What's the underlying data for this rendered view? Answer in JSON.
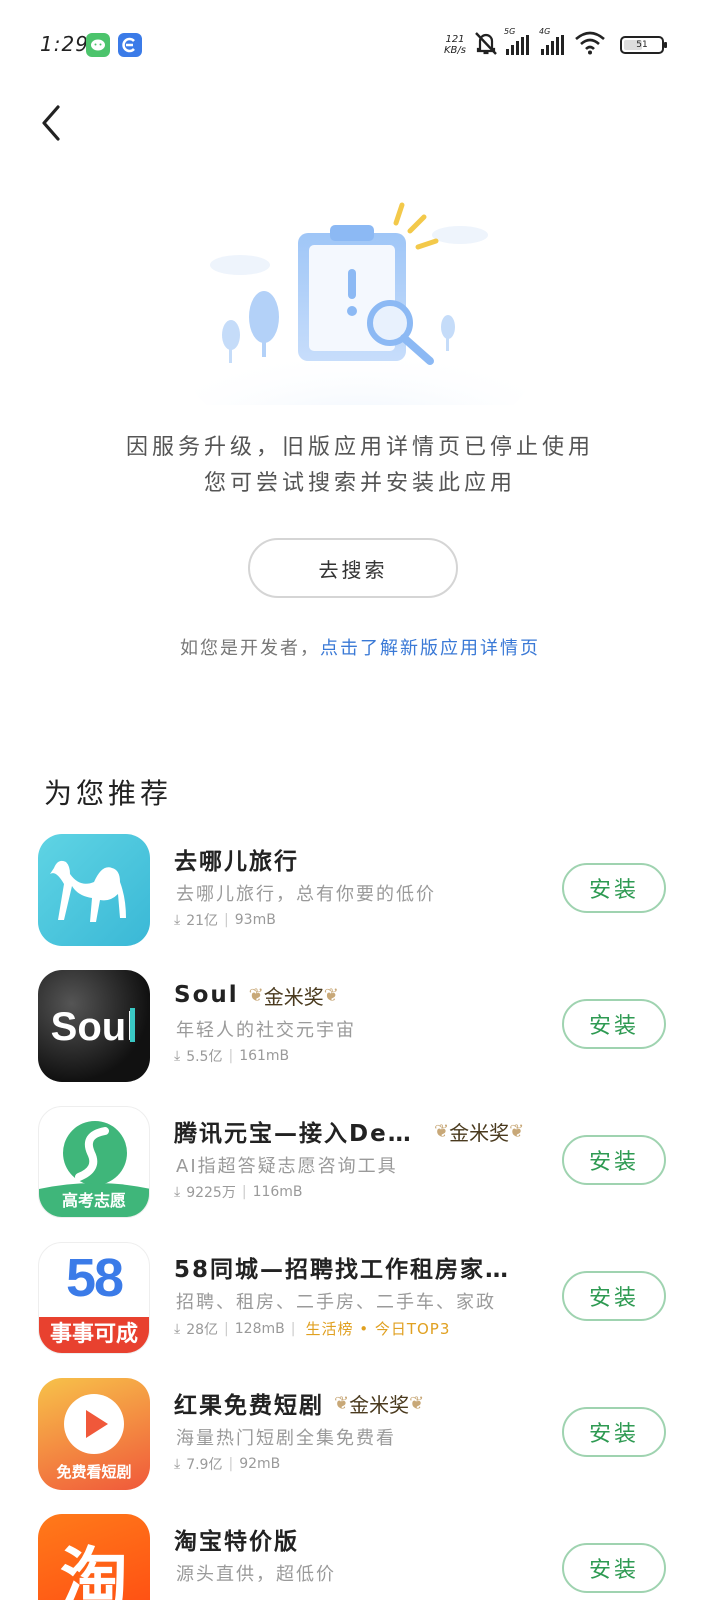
{
  "status_bar": {
    "time": "1:29",
    "net_speed_value": "121",
    "net_speed_unit": "KB/s",
    "signal_tag_1": "5G",
    "signal_tag_2": "4G",
    "battery": "51",
    "battery_level": 0.51
  },
  "notice": {
    "line1": "因服务升级，旧版应用详情页已停止使用",
    "line2": "您可尝试搜索并安装此应用"
  },
  "search_button": "去搜索",
  "developer": {
    "prefix": "如您是开发者，",
    "link": "点击了解新版应用详情页"
  },
  "recommend": {
    "title": "为您推荐",
    "install_label": "安装",
    "award_label": "金米奖",
    "apps": [
      {
        "name": "去哪儿旅行",
        "desc": "去哪儿旅行，总有你要的低价",
        "downloads": "21亿",
        "size": "93mB",
        "award": false,
        "hot": ""
      },
      {
        "name": "Soul",
        "desc": "年轻人的社交元宇宙",
        "downloads": "5.5亿",
        "size": "161mB",
        "award": true,
        "hot": ""
      },
      {
        "name": "腾讯元宝—接入Dee…",
        "desc": "AI指超答疑志愿咨询工具",
        "downloads": "9225万",
        "size": "116mB",
        "award": true,
        "hot": "",
        "icon_text": "高考志愿"
      },
      {
        "name": "58同城—招聘找工作租房家…",
        "desc": "招聘、租房、二手房、二手车、家政",
        "downloads": "28亿",
        "size": "128mB",
        "award": false,
        "hot": "生活榜 • 今日TOP3",
        "icon_text": "事事可成",
        "icon_number": "58"
      },
      {
        "name": "红果免费短剧",
        "desc": "海量热门短剧全集免费看",
        "downloads": "7.9亿",
        "size": "92mB",
        "award": true,
        "hot": "",
        "icon_text": "免费看短剧"
      },
      {
        "name": "淘宝特价版",
        "desc": "源头直供，超低价",
        "downloads": "",
        "size": "",
        "award": false,
        "hot": "",
        "icon_text": "淘"
      }
    ]
  },
  "colors": {
    "install_green": "#2e9a52",
    "link_blue": "#3a79d6",
    "hot_orange": "#e0a020"
  }
}
